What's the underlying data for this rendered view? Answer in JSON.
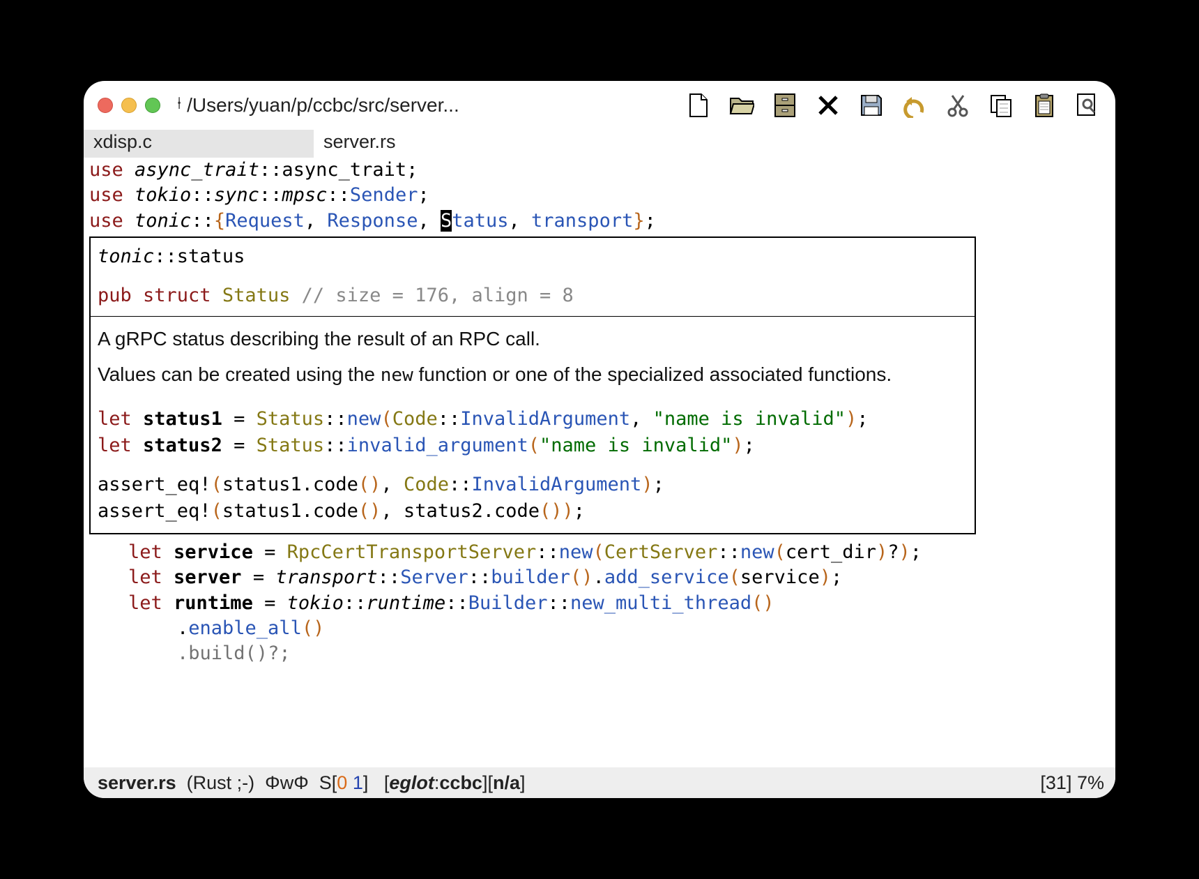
{
  "titlebar": {
    "vc_glyph": "⍿",
    "title": "/Users/yuan/p/ccbc/src/server..."
  },
  "toolbar_icons": [
    "new-file",
    "open-folder",
    "drawer",
    "close",
    "save",
    "undo",
    "cut",
    "copy",
    "paste",
    "find"
  ],
  "tabs": [
    {
      "label": "xdisp.c",
      "active": false
    },
    {
      "label": "server.rs",
      "active": true
    }
  ],
  "code": {
    "l1": {
      "use": "use ",
      "mod": "async_trait",
      "rest": "::async_trait;"
    },
    "l2": {
      "use": "use ",
      "mod": "tokio",
      "a": "::",
      "sync": "sync",
      "b": "::",
      "mpsc": "mpsc",
      "c": "::",
      "sender": "Sender",
      ";": ";"
    },
    "l3": {
      "use": "use ",
      "mod": "tonic",
      "a": "::",
      "ob": "{",
      "req": "Request",
      ", ": ", ",
      "resp": "Response",
      ", 2": ", ",
      "cur": "S",
      "tatus": "tatus",
      ", 3": ", ",
      "tr": "transport",
      "cb": "}",
      "s": ";"
    }
  },
  "popup": {
    "crumb": {
      "mod": "tonic",
      "sep": "::status"
    },
    "sig": {
      "pub": "pub ",
      "struct": "struct ",
      "name": "Status ",
      "comment": "// size = 176, align = 8"
    },
    "doc1": "A gRPC status describing the result of an RPC call.",
    "doc2a": "Values can be created using the ",
    "doc2_mono": "new",
    "doc2b": " function or one of the specialized associated functions.",
    "ex": {
      "l1": {
        "let": "let ",
        "v": "status1",
        "eq": " = ",
        "ty": "Status",
        "cc": "::",
        "fn": "new",
        "op": "(",
        "ty2": "Code",
        "cc2": "::",
        "variant": "InvalidArgument",
        "comma": ", ",
        "str": "\"name is invalid\"",
        "cp": ")",
        "s": ";"
      },
      "l2": {
        "let": "let ",
        "v": "status2",
        "eq": " = ",
        "ty": "Status",
        "cc": "::",
        "fn": "invalid_argument",
        "op": "(",
        "str": "\"name is invalid\"",
        "cp": ")",
        "s": ";"
      },
      "l3": {
        "a": "assert_eq!",
        "op": "(",
        "b": "status1.code",
        "po": "()",
        "c": ", ",
        "ty": "Code",
        "cc": "::",
        "variant": "InvalidArgument",
        "cp": ")",
        "s": ";"
      },
      "l4": {
        "a": "assert_eq!",
        "op": "(",
        "b": "status1.code",
        "po": "()",
        "c": ", status2.code",
        "po2": "()",
        "cp": ")",
        "s": ";"
      }
    }
  },
  "below": {
    "l1": {
      "let": "let ",
      "v": "service",
      "eq": " = ",
      "ty": "RpcCertTransportServer",
      "cc": "::",
      "fn": "new",
      "op": "(",
      "ty2": "CertServer",
      "cc2": "::",
      "fn2": "new",
      "op2": "(",
      "arg": "cert_dir",
      "cp2": ")",
      "q": "?",
      "cp": ")",
      "s": ";"
    },
    "l2": {
      "let": "let ",
      "v": "server",
      "eq": " = ",
      "mod": "transport",
      "cc": "::",
      "ty": "Server",
      "cc2": "::",
      "fn": "builder",
      "po": "()",
      "dot": ".",
      "fn2": "add_service",
      "op": "(",
      "arg": "service",
      "cp": ")",
      "s": ";"
    },
    "l3": {
      "let": "let ",
      "v": "runtime",
      "eq": " = ",
      "mod": "tokio",
      "cc": "::",
      "mod2": "runtime",
      "cc2": "::",
      "ty": "Builder",
      "cc3": "::",
      "fn": "new_multi_thread",
      "po": "()"
    },
    "l4": {
      "dot": ".",
      "fn": "enable_all",
      "po": "()"
    },
    "l5": {
      "dot": ".",
      "fn": "build",
      "po": "()",
      "q": "?",
      "s": ";"
    }
  },
  "modeline": {
    "file": "server.rs",
    "mode": "(Rust ;-)",
    "ow": "ΦwΦ",
    "S": "S[",
    "e": "0 ",
    "w": "1",
    "Sb": "]",
    "eg_ob": "[",
    "eg": "eglot",
    "colon": ":",
    "eg2": "ccbc",
    "eg_cb": "]",
    "na_ob": " [",
    "na": "n/a",
    "na_cb": "]",
    "right_ob": "[",
    "right_n": "31",
    "right_cb": "] ",
    "pct": "7%"
  }
}
